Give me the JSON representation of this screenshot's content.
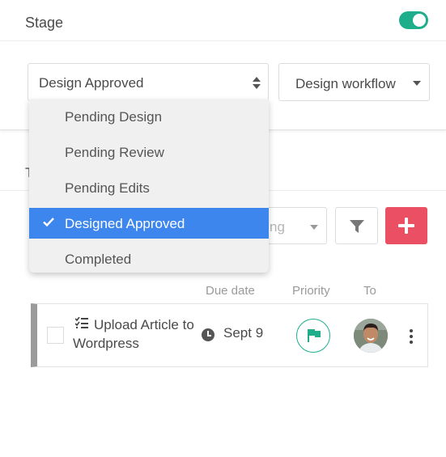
{
  "stage": {
    "title": "Stage",
    "toggle_on": true
  },
  "stage_select": {
    "value": "Design Approved"
  },
  "workflow_select": {
    "value": "Design workflow"
  },
  "stage_dropdown": {
    "options": [
      {
        "label": "Pending Design",
        "selected": false
      },
      {
        "label": "Pending Review",
        "selected": false
      },
      {
        "label": "Pending Edits",
        "selected": false
      },
      {
        "label": "Designed Approved",
        "selected": true
      },
      {
        "label": "Completed",
        "selected": false
      }
    ]
  },
  "tab_partial": "T",
  "sort_select": {
    "value_partial": "ng"
  },
  "columns": {
    "due_date": "Due date",
    "priority": "Priority",
    "to": "To"
  },
  "task": {
    "title": "Upload Article to Wordpress",
    "due_date": "Sept 9",
    "priority_icon": "flag-icon",
    "assignee_icon": "avatar"
  },
  "colors": {
    "accent_green": "#1fae8c",
    "add_button_red": "#ea4f63",
    "selected_blue": "#3d86ee",
    "row_border_gray": "#9b9b9b"
  }
}
